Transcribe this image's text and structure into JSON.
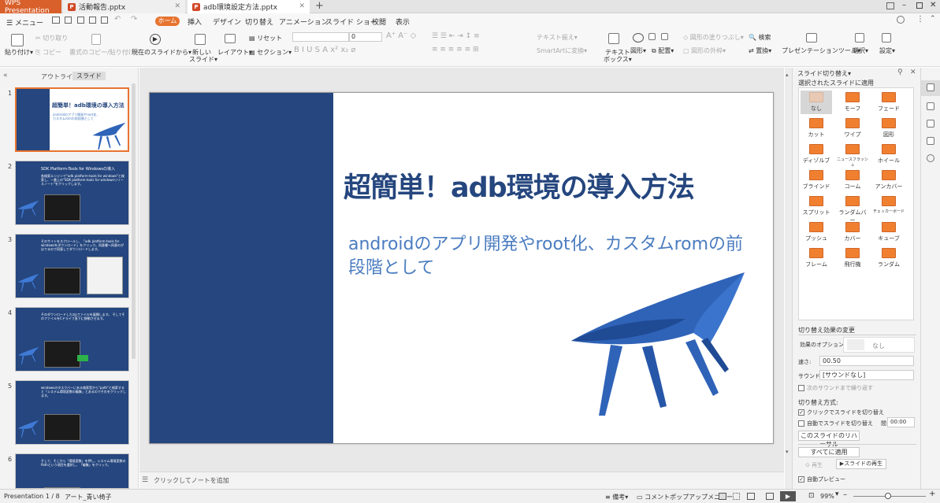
{
  "titlebar": {
    "tabs": [
      {
        "label": "WPS Presentation"
      },
      {
        "label": "活動報告.pptx"
      },
      {
        "label": "adb環境設定方法.pptx"
      }
    ],
    "new_tab": "+"
  },
  "menubar": {
    "menu_label": "メニュー",
    "tabs": [
      "ホーム",
      "挿入",
      "デザイン",
      "切り替え",
      "アニメーション",
      "スライド ショー",
      "校閲",
      "表示"
    ],
    "active_tab": "ホーム"
  },
  "ribbon": {
    "paste": "貼り付け",
    "cut": "切り取り",
    "copy": "コピー",
    "format_painter": "書式のコピー/貼り付け",
    "from_current": "現在のスライドから",
    "new_slide": "新しい",
    "new_slide2": "スライド",
    "layout": "レイアウト",
    "reset": "リセット",
    "section": "セクション",
    "font_size": "0",
    "text_align": "テキスト揃え",
    "smartart": "SmartArtに変換",
    "textbox": "テキスト",
    "textbox2": "ボックス",
    "shape": "図形",
    "arrange": "配置",
    "shape_fill": "図形の塗りつぶし",
    "shape_outline": "図形の外枠",
    "find": "検索",
    "replace": "置換",
    "presentation_tools": "プレゼンテーションツール",
    "select": "選択",
    "settings": "設定"
  },
  "leftpanel": {
    "tab_outline": "アウトライン",
    "tab_slides": "スライド",
    "thumbs": [
      {
        "num": "1",
        "title": "超簡単！adb環境の導入方法",
        "text": "androidのアプリ開発やroot化、カスタムromの前段階として"
      },
      {
        "num": "2",
        "title": "SDK Platform-Tools for Windowsの導入",
        "text": "各検索エンジンで\"adb platform-tools for windows\"と検索し、一番上の\"SDK platform-tools for windowsリリースノート\"をクリックします。"
      },
      {
        "num": "3",
        "title": "",
        "text": "そのサイトをスクロールし、「adk platform-tools for windowsをダウンロード」をクリック。同意書へ同意のがはでるので同意してダウンロードします。"
      },
      {
        "num": "4",
        "title": "",
        "text": "そのダウンロードしたzipファイルを展開します。 そしてそのファイルをCドライブ直下に移動させます。"
      },
      {
        "num": "5",
        "title": "",
        "text": "windowsのタスクバーにある検索窓から\"path\"と検索すると「システム環境変数の編集」とあるのでそれをクリックします。"
      },
      {
        "num": "6",
        "title": "",
        "text": "そして、そこから「環境変数」を押し、システム環境変数のPathという項目を選択し、「編集」をクリック。"
      }
    ]
  },
  "slide": {
    "title": "超簡単！adb環境の導入方法",
    "subtitle": "androidのアプリ開発やroot化、カスタムromの前段階として"
  },
  "notes": {
    "placeholder": "クリックしてノートを追加"
  },
  "rightpanel": {
    "header": "スライド切り替え",
    "apply_label": "選択されたスライドに適用",
    "transitions": [
      "なし",
      "モーフ",
      "フェード",
      "カット",
      "ワイプ",
      "図形",
      "ディゾルブ",
      "ニュースフラッシュ",
      "ホイール",
      "ブラインド",
      "コーム",
      "アンカバー",
      "スプリット",
      "ランダムバー",
      "チェッカーボード",
      "プッシュ",
      "カバー",
      "キューブ",
      "フレーム",
      "飛行機",
      "ランダム"
    ],
    "modify_label": "切り替え効果の変更",
    "effect_option_label": "効果のオプション：",
    "effect_option_value": "なし",
    "speed_label": "速さ:",
    "speed_value": "00.50",
    "sound_label": "サウンド:",
    "sound_value": "[サウンドなし]",
    "loop_label": "次のサウンドまで繰り返す",
    "advance_label": "切り替え方式:",
    "on_click_label": "クリックでスライドを切り替え",
    "auto_label": "自動でスライドを切り替え",
    "interval_label": "間",
    "interval_value": "00:00",
    "rehearse_label": "このスライドのリハーサル",
    "apply_all_label": "すべてに適用",
    "replay_label": "再生",
    "play_slide_label": "スライドの再生",
    "autopreview_label": "自動プレビュー"
  },
  "statusbar": {
    "slide_count": "Presentation 1 / 8",
    "theme": "アート_青い椅子",
    "notes": "備考",
    "comments": "コメントポップアップメニュー",
    "zoom": "99%"
  },
  "colors": {
    "accent": "#e7742f",
    "slide_blue": "#25467e",
    "subtitle": "#4a7cc0",
    "chair": "#2f63b8"
  }
}
